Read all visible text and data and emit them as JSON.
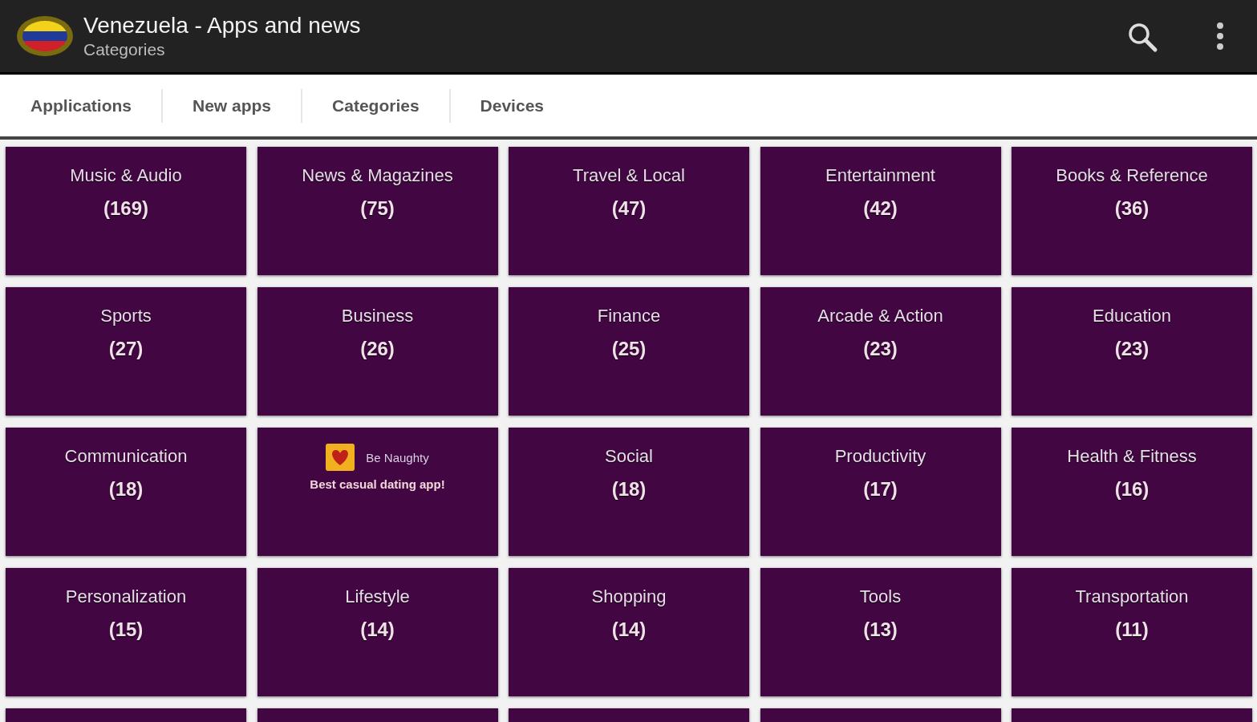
{
  "app_bar": {
    "title": "Venezuela - Apps and news",
    "subtitle": "Categories"
  },
  "tabs": [
    {
      "label": "Applications"
    },
    {
      "label": "New apps"
    },
    {
      "label": "Categories"
    },
    {
      "label": "Devices"
    }
  ],
  "tiles": [
    {
      "kind": "category",
      "name": "Music & Audio",
      "count": "(169)"
    },
    {
      "kind": "category",
      "name": "News & Magazines",
      "count": "(75)"
    },
    {
      "kind": "category",
      "name": "Travel & Local",
      "count": "(47)"
    },
    {
      "kind": "category",
      "name": "Entertainment",
      "count": "(42)"
    },
    {
      "kind": "category",
      "name": "Books & Reference",
      "count": "(36)"
    },
    {
      "kind": "category",
      "name": "Sports",
      "count": "(27)"
    },
    {
      "kind": "category",
      "name": "Business",
      "count": "(26)"
    },
    {
      "kind": "category",
      "name": "Finance",
      "count": "(25)"
    },
    {
      "kind": "category",
      "name": "Arcade & Action",
      "count": "(23)"
    },
    {
      "kind": "category",
      "name": "Education",
      "count": "(23)"
    },
    {
      "kind": "category",
      "name": "Communication",
      "count": "(18)"
    },
    {
      "kind": "ad",
      "title": "Be Naughty",
      "tagline": "Best casual dating app!"
    },
    {
      "kind": "category",
      "name": "Social",
      "count": "(18)"
    },
    {
      "kind": "category",
      "name": "Productivity",
      "count": "(17)"
    },
    {
      "kind": "category",
      "name": "Health & Fitness",
      "count": "(16)"
    },
    {
      "kind": "category",
      "name": "Personalization",
      "count": "(15)"
    },
    {
      "kind": "category",
      "name": "Lifestyle",
      "count": "(14)"
    },
    {
      "kind": "category",
      "name": "Shopping",
      "count": "(14)"
    },
    {
      "kind": "category",
      "name": "Tools",
      "count": "(13)"
    },
    {
      "kind": "category",
      "name": "Transportation",
      "count": "(11)"
    },
    {
      "kind": "blank"
    },
    {
      "kind": "blank"
    },
    {
      "kind": "blank"
    },
    {
      "kind": "blank"
    },
    {
      "kind": "blank"
    }
  ]
}
